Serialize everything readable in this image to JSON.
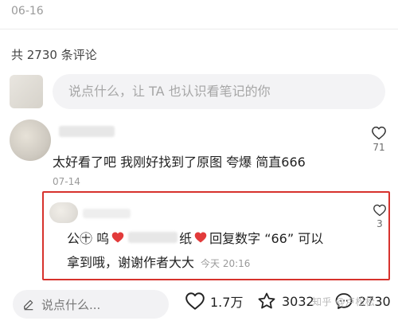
{
  "header": {
    "date": "06-16",
    "comment_count_label": "共 2730 条评论"
  },
  "compose": {
    "placeholder": "说点什么，让 TA 也认识看笔记的你"
  },
  "comments": [
    {
      "text": "太好看了吧 我刚好找到了原图 夸爆 简直666",
      "date": "07-14",
      "likes": "71",
      "reply": {
        "line1_prefix": "公㊉ 呜 ",
        "line1_suffix": "回复数字 “66” 可以",
        "line1_mid": "纸",
        "line2": "拿到哦，谢谢作者大大",
        "time": "今天 20:16",
        "likes": "3"
      }
    }
  ],
  "bottom": {
    "input_placeholder": "说点什么...",
    "likes": "1.7万",
    "stars": "3032",
    "comments": "2730"
  },
  "watermark": "知乎 @卢松松",
  "colors": {
    "highlight": "#d7322d",
    "heart": "#e23b3b"
  }
}
